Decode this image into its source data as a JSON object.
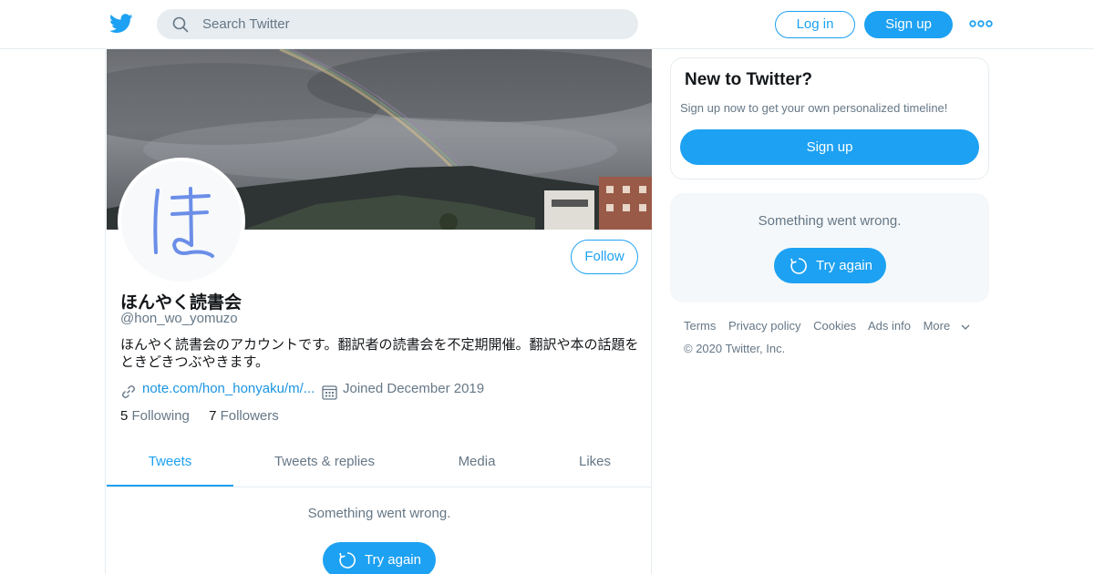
{
  "topbar": {
    "search_placeholder": "Search Twitter",
    "login_label": "Log in",
    "signup_label": "Sign up",
    "logo_icon": "twitter-bird-icon",
    "more_icon": "more-dots-icon"
  },
  "profile": {
    "name": "ほんやく読書会",
    "handle": "@hon_wo_yomuzo",
    "bio": "ほんやく読書会のアカウントです。翻訳者の読書会を不定期開催。翻訳や本の話題をときどきつぶやきます。",
    "link": "note.com/hon_honyaku/m/...",
    "joined": "Joined December 2019",
    "following_count": "5",
    "following_label": "Following",
    "followers_count": "7",
    "followers_label": "Followers",
    "follow_label": "Follow",
    "avatar_glyph": "ほ"
  },
  "tabs": [
    {
      "label": "Tweets",
      "active": true
    },
    {
      "label": "Tweets & replies",
      "active": false
    },
    {
      "label": "Media",
      "active": false
    },
    {
      "label": "Likes",
      "active": false
    }
  ],
  "timeline": {
    "error_text": "Something went wrong.",
    "retry_label": "Try again"
  },
  "sidebar": {
    "new_title": "New to Twitter?",
    "new_subtitle": "Sign up now to get your own personalized timeline!",
    "signup_label": "Sign up",
    "error_text": "Something went wrong.",
    "retry_label": "Try again"
  },
  "footer": {
    "links": [
      "Terms",
      "Privacy policy",
      "Cookies",
      "Ads info",
      "More"
    ],
    "copyright": "© 2020 Twitter, Inc."
  },
  "colors": {
    "accent": "#1da1f2",
    "secondary_text": "#657786",
    "border": "#e6ecf0",
    "card_bg": "#f5f8fa"
  }
}
